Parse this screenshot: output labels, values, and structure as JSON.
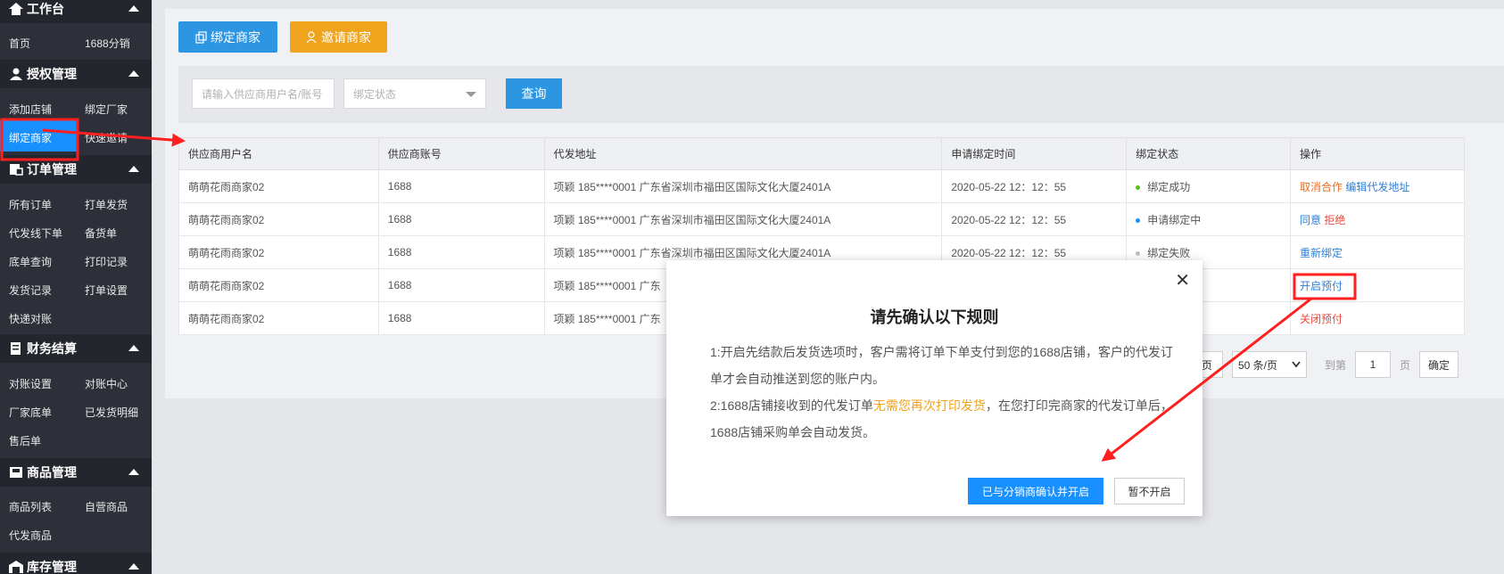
{
  "sidebar": {
    "sections": [
      {
        "title": "工作台",
        "icon": "home-icon"
      },
      {
        "title": "授权管理",
        "icon": "user-icon"
      },
      {
        "title": "订单管理",
        "icon": "order-icon"
      },
      {
        "title": "财务结算",
        "icon": "finance-icon"
      },
      {
        "title": "商品管理",
        "icon": "product-icon"
      },
      {
        "title": "库存管理",
        "icon": "warehouse-icon"
      }
    ],
    "items": [
      "首页",
      "1688分销",
      "添加店铺",
      "绑定厂家",
      "绑定商家",
      "快速邀请",
      "所有订单",
      "打单发货",
      "代发线下单",
      "备货单",
      "底单查询",
      "打印记录",
      "发货记录",
      "打单设置",
      "快递对账",
      "对账设置",
      "对账中心",
      "厂家底单",
      "已发货明细",
      "售后单",
      "商品列表",
      "自营商品",
      "代发商品"
    ],
    "active_index": 4
  },
  "toolbar": {
    "bind_label": "绑定商家",
    "invite_label": "邀请商家"
  },
  "filter": {
    "name_placeholder": "请输入供应商用户名/账号",
    "status_placeholder": "绑定状态",
    "query_label": "查询"
  },
  "table": {
    "headers": [
      "供应商用户名",
      "供应商账号",
      "代发地址",
      "申请绑定时间",
      "绑定状态",
      "操作"
    ],
    "rows": [
      {
        "name": "萌萌花雨商家02",
        "account": "1688",
        "address": "项颖 185****0001 广东省深圳市福田区国际文化大厦2401A",
        "time": "2020-05-22 12：12：55",
        "status": "绑定成功",
        "status_color": "#52c41a",
        "actions": [
          "取消合作",
          "编辑代发地址"
        ]
      },
      {
        "name": "萌萌花雨商家02",
        "account": "1688",
        "address": "项颖 185****0001 广东省深圳市福田区国际文化大厦2401A",
        "time": "2020-05-22 12：12：55",
        "status": "申请绑定中",
        "status_color": "#1890ff",
        "actions": [
          "同意",
          "拒绝"
        ]
      },
      {
        "name": "萌萌花雨商家02",
        "account": "1688",
        "address": "项颖 185****0001 广东省深圳市福田区国际文化大厦2401A",
        "time": "2020-05-22 12：12：55",
        "status": "绑定失败",
        "status_color": "#bfbfbf",
        "actions": [
          "重新绑定"
        ]
      },
      {
        "name": "萌萌花雨商家02",
        "account": "1688",
        "address": "项颖 185****0001 广东",
        "time": "",
        "status": "",
        "status_color": "",
        "actions": [
          "开启预付"
        ]
      },
      {
        "name": "萌萌花雨商家02",
        "account": "1688",
        "address": "项颖 185****0001 广东",
        "time": "",
        "status": "",
        "status_color": "",
        "actions": [
          "关闭预付"
        ]
      }
    ]
  },
  "pagination": {
    "prev_fragment": "页",
    "page_size": "50 条/页",
    "goto_prefix": "到第",
    "page_value": "1",
    "goto_suffix": "页",
    "confirm_label": "确定"
  },
  "modal": {
    "title": "请先确认以下规则",
    "line1": "1:开启先结款后发货选项时，客户需将订单下单支付到您的1688店铺，客户的代发订单才会自动推送到您的账户内。",
    "line2_pre": "2:1688店铺接收到的代发订单",
    "line2_hl": "无需您再次打印发货",
    "line2_post": "，在您打印完商家的代发订单后，1688店铺采购单会自动发货。",
    "confirm_label": "已与分销商确认并开启",
    "cancel_label": "暂不开启",
    "close_glyph": "✕"
  },
  "colors": {
    "primary": "#2d96e3",
    "accent": "#f0a31c",
    "annotation": "#ff1f1f",
    "sidebar_bg": "#2d3038"
  }
}
